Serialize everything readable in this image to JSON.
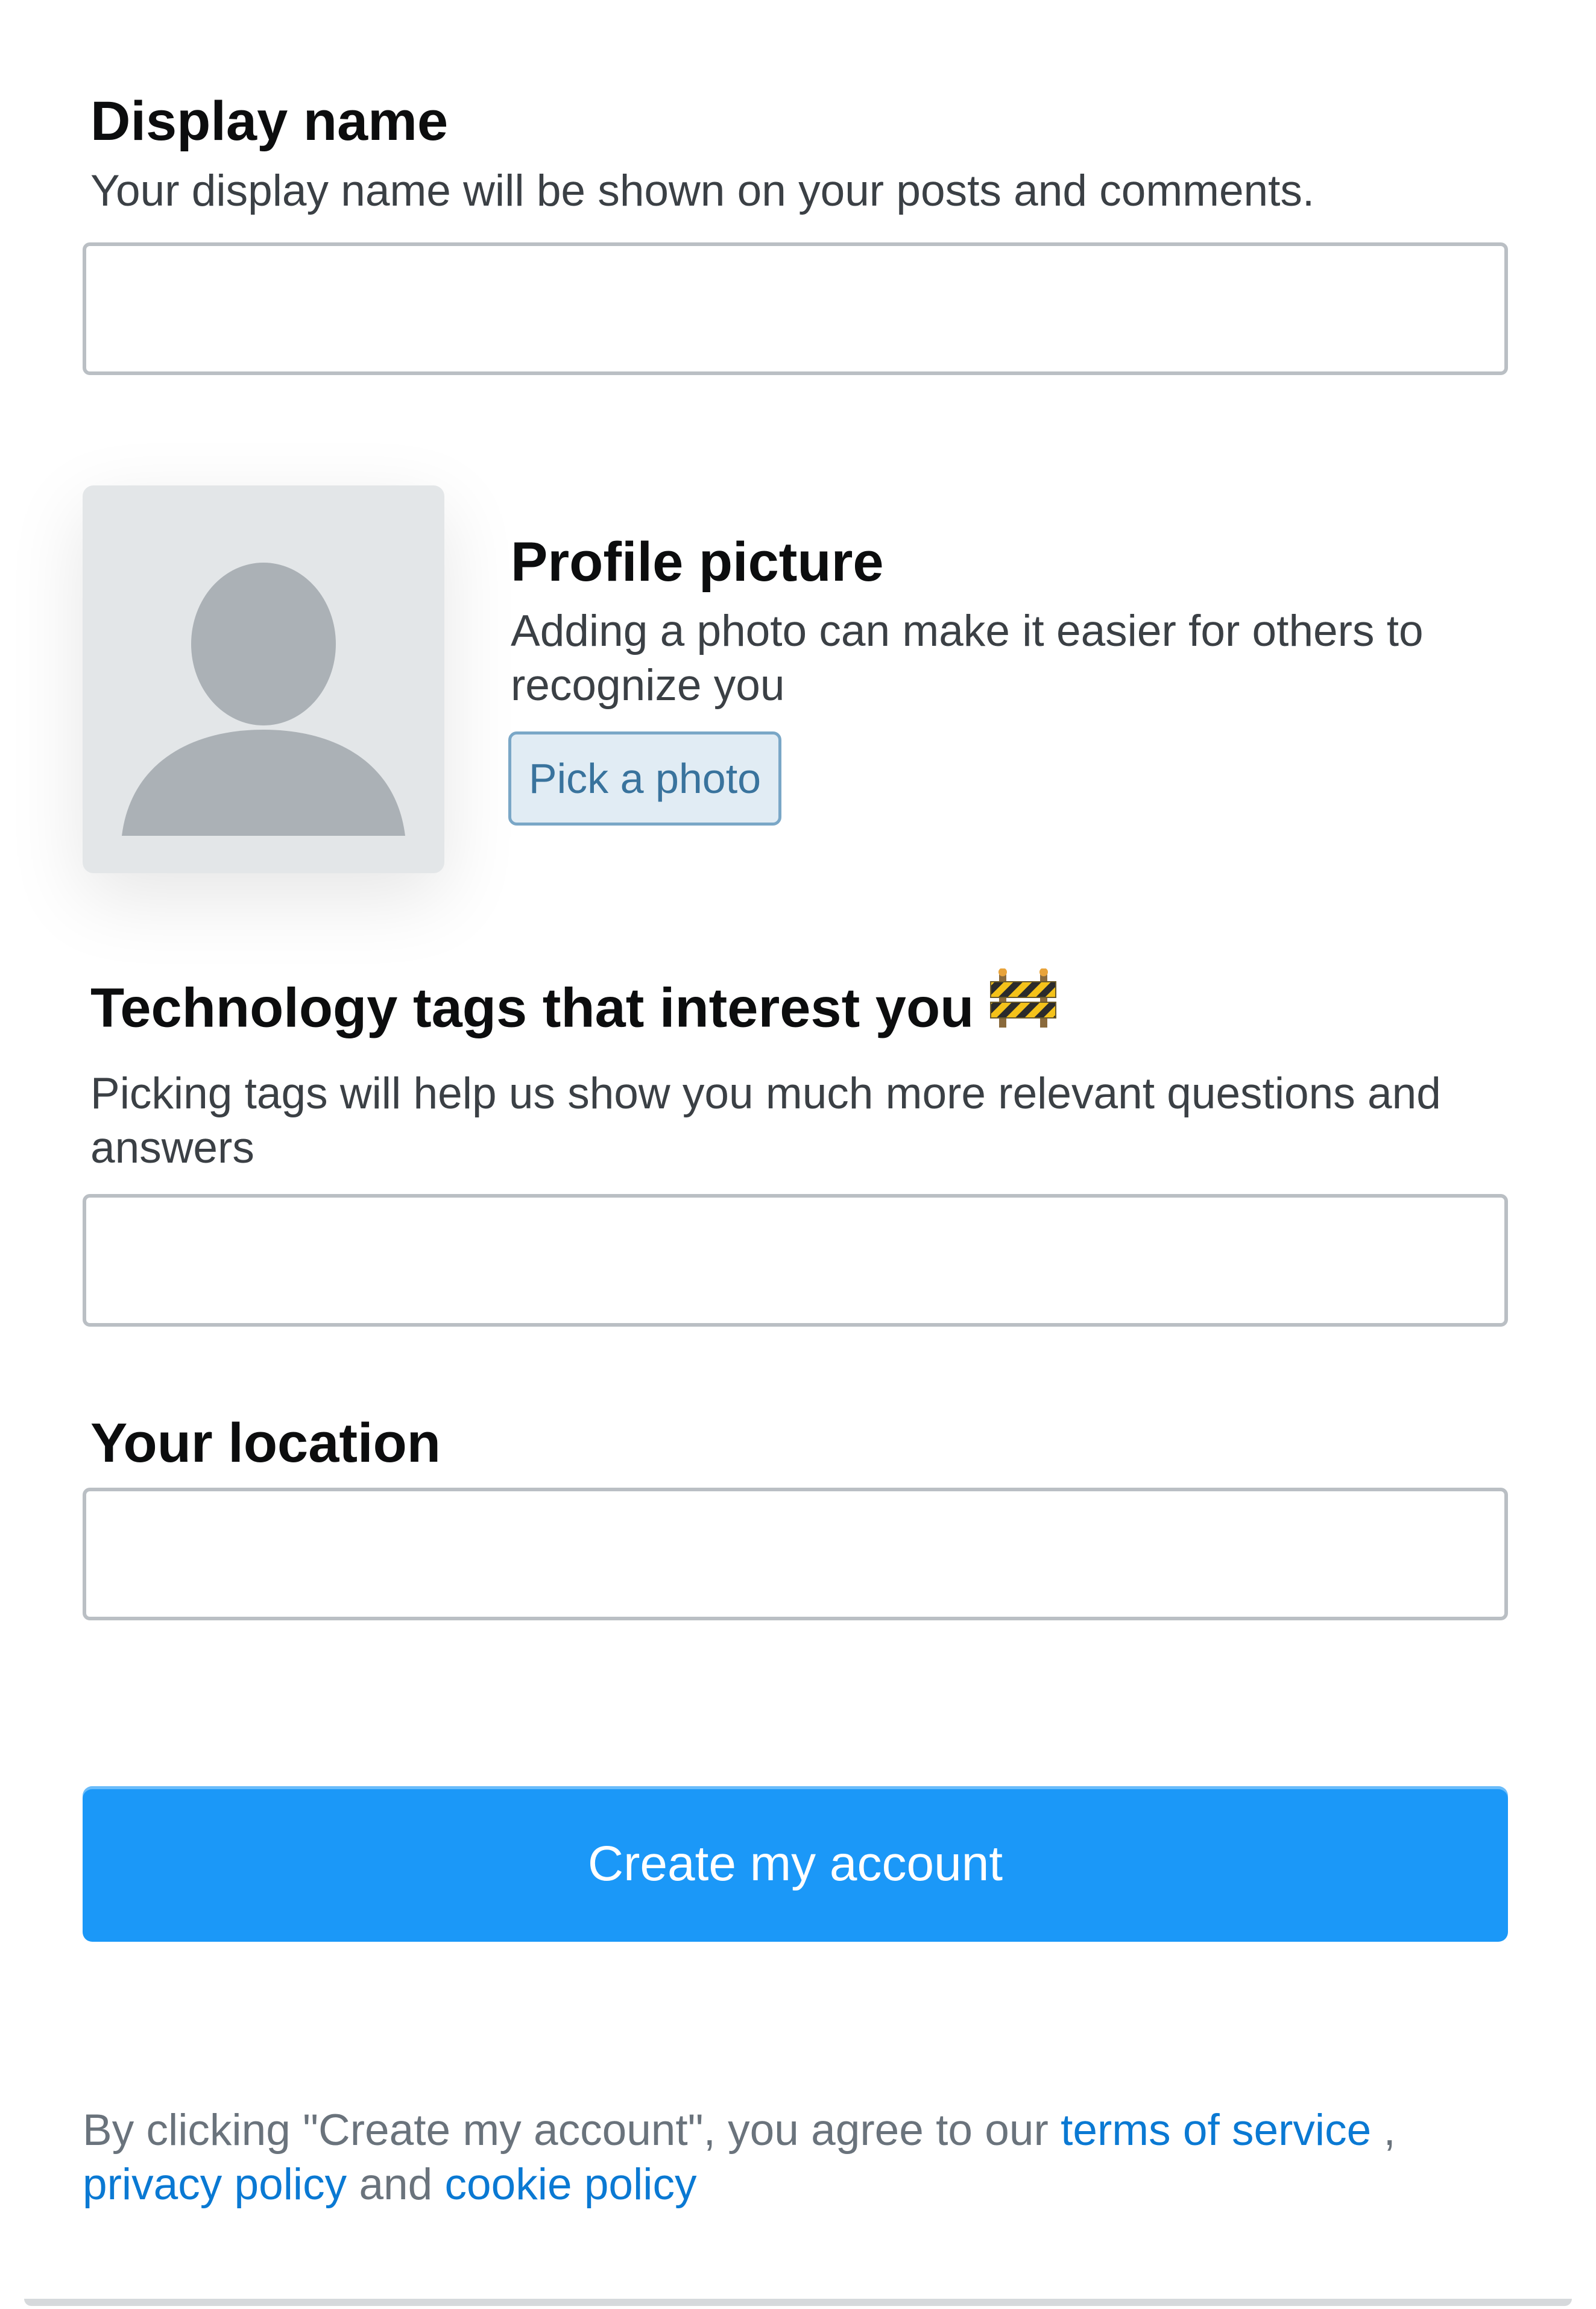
{
  "display_name": {
    "title": "Display name",
    "description": "Your display name will be shown on your posts and comments.",
    "value": "",
    "placeholder": ""
  },
  "profile_picture": {
    "title": "Profile picture",
    "description": "Adding a photo can make it easier for others to recognize you",
    "button_label": "Pick a photo",
    "avatar_icon": "default-user-silhouette"
  },
  "tags": {
    "title": "Technology tags that interest you",
    "title_icon": "construction-barrier-emoji",
    "description": "Picking tags will help us show you much more relevant questions and answers",
    "value": "",
    "placeholder": ""
  },
  "location": {
    "title": "Your location",
    "value": "",
    "placeholder": ""
  },
  "submit": {
    "label": "Create my account"
  },
  "legal": {
    "prefix": "By clicking \"Create my account\", you agree to our ",
    "terms_label": "terms of service",
    "sep1": " , ",
    "privacy_label": "privacy policy",
    "sep2": " and ",
    "cookie_label": "cookie policy"
  },
  "colors": {
    "primary_button": "#1b98f8",
    "link": "#0a79d3",
    "secondary_button_bg": "#e1ecf4",
    "secondary_button_text": "#39739d",
    "input_border": "#babfc4",
    "avatar_bg": "#e3e6e8",
    "avatar_silhouette": "#abb1b6"
  }
}
